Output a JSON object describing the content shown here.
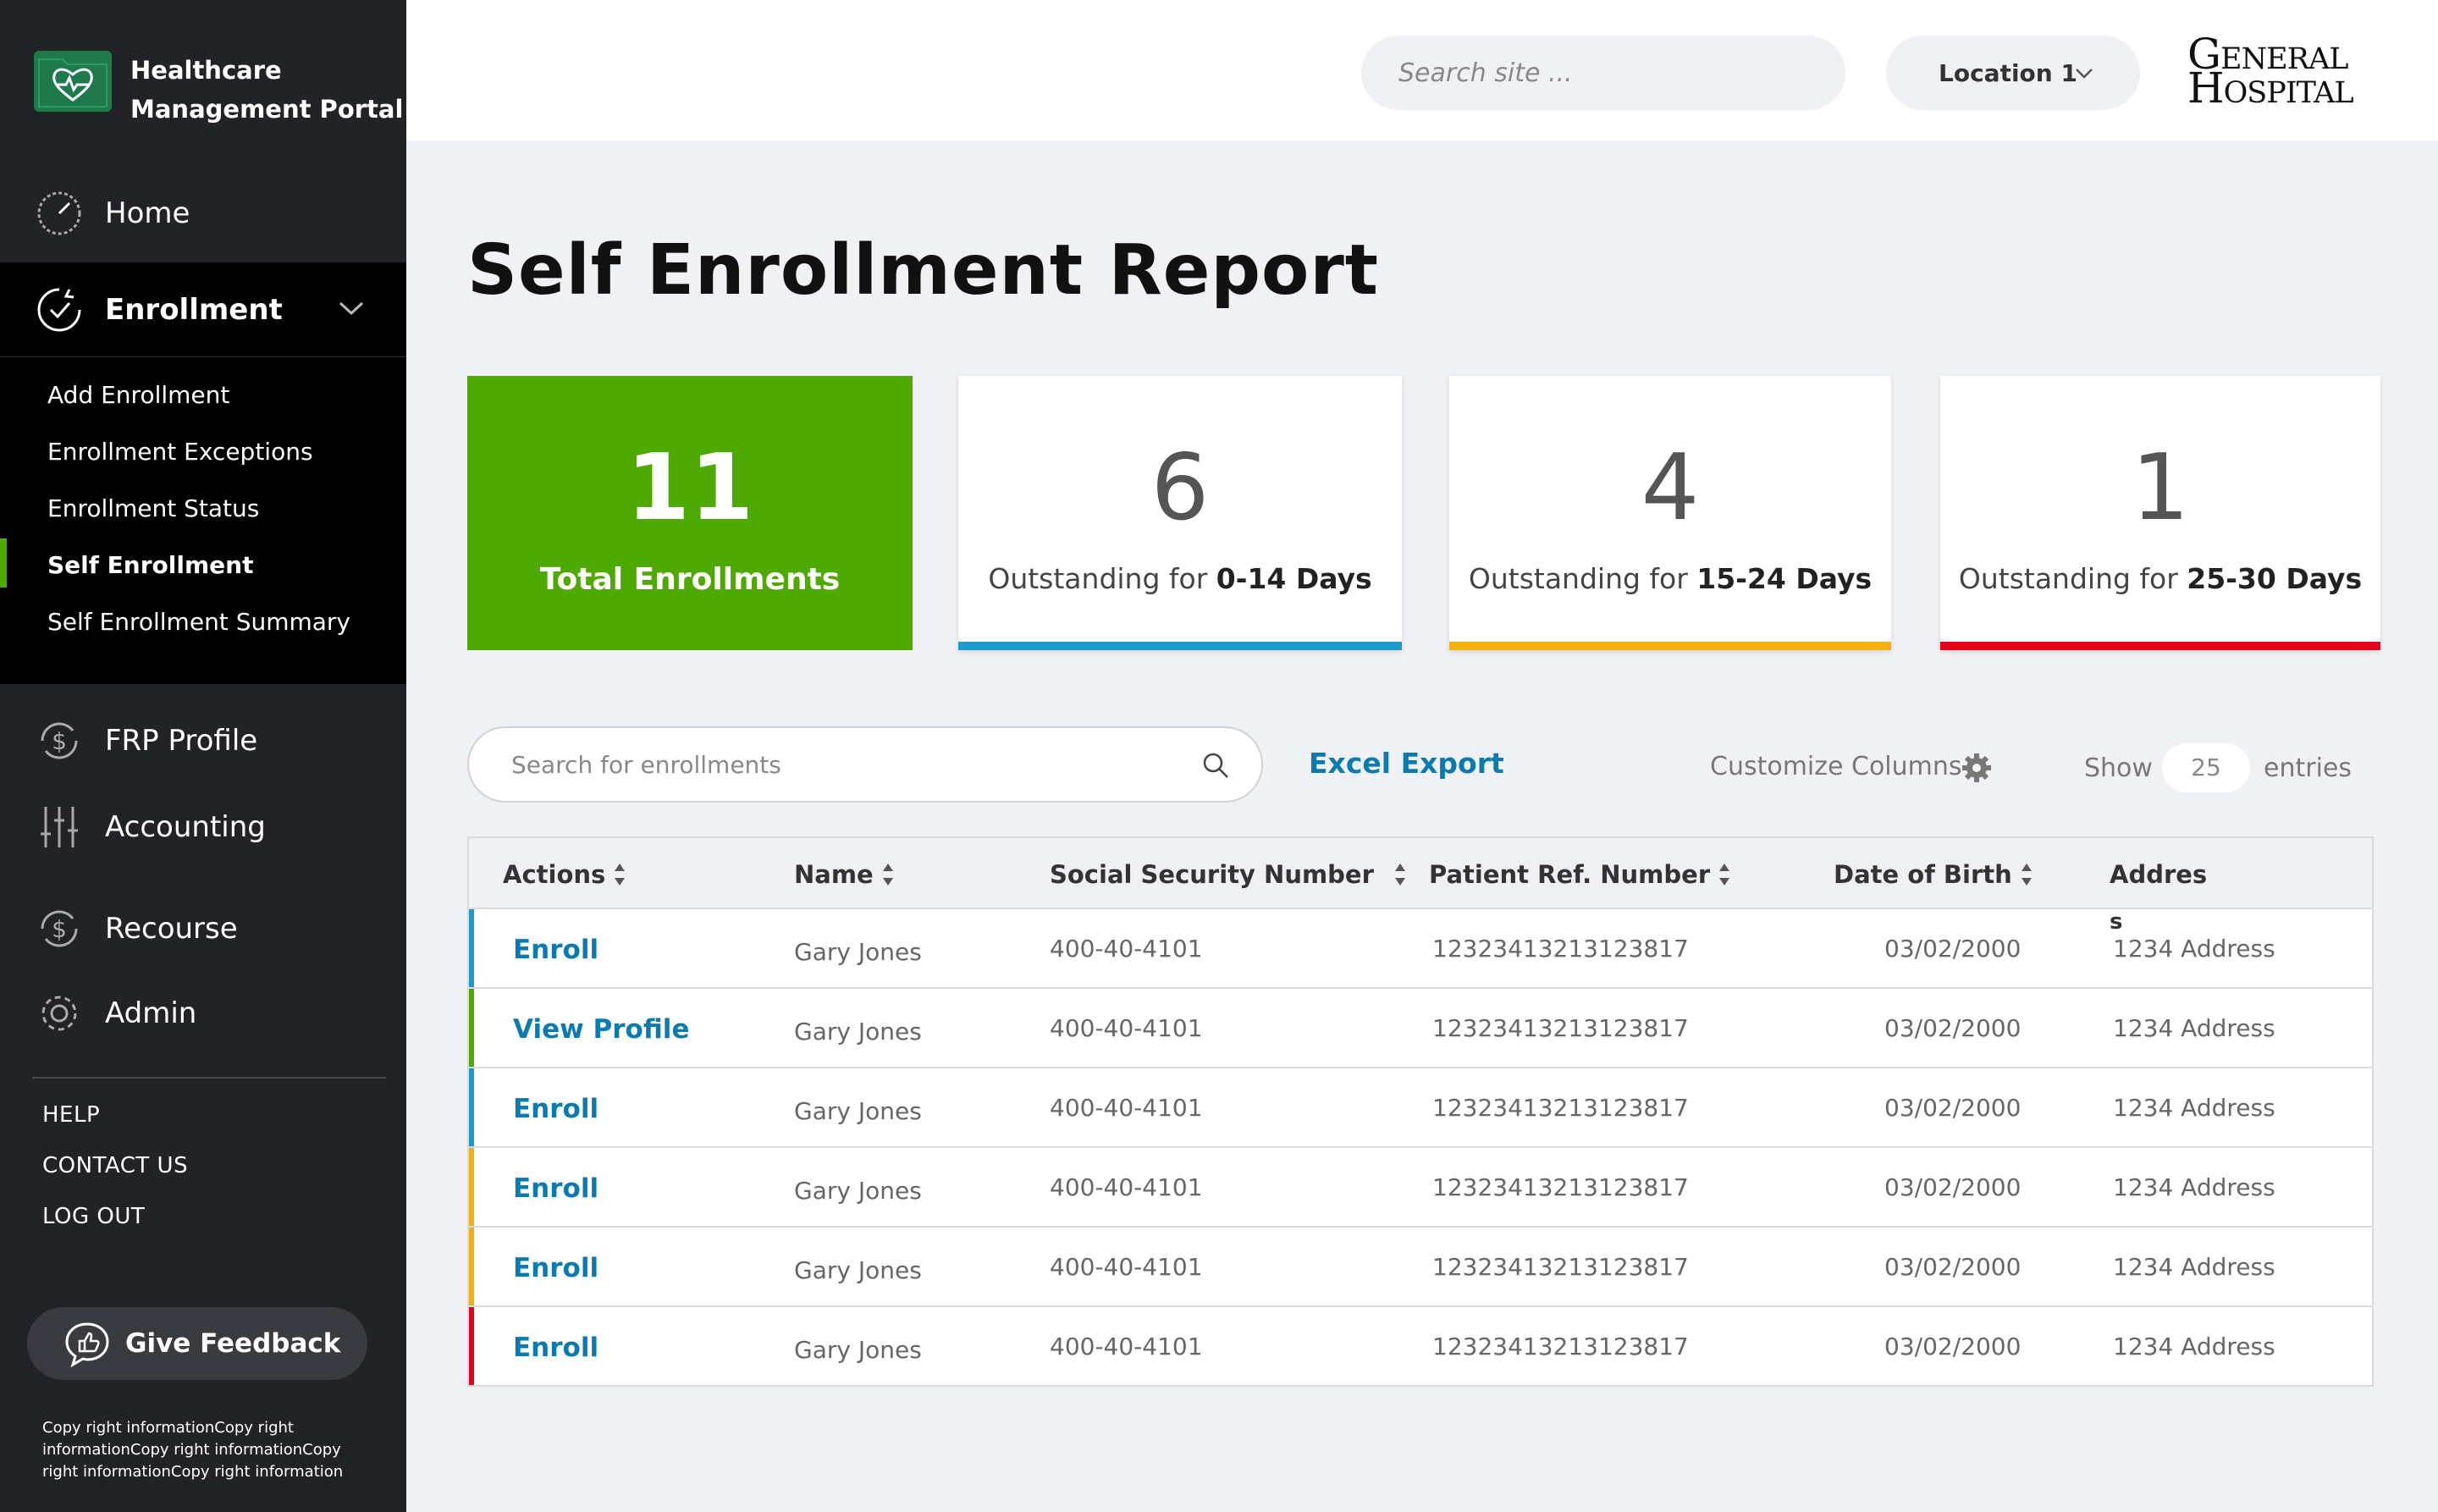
{
  "app": {
    "title_line1": "Healthcare",
    "title_line2": "Management Portal"
  },
  "sidebar": {
    "home": "Home",
    "enrollment": "Enrollment",
    "submenu": [
      "Add Enrollment",
      "Enrollment Exceptions",
      "Enrollment Status",
      "Self Enrollment",
      "Self Enrollment Summary"
    ],
    "active_submenu": "Self Enrollment",
    "frp_profile": "FRP Profile",
    "accounting": "Accounting",
    "recourse": "Recourse",
    "admin": "Admin",
    "help": "HELP",
    "contact": "CONTACT US",
    "logout": "LOG OUT",
    "feedback": "Give Feedback",
    "copyright": "Copy right informationCopy right informationCopy right informationCopy right informationCopy right information"
  },
  "header": {
    "search_placeholder": "Search site ...",
    "location": "Location 1",
    "logo_line1": "General",
    "logo_line2": "Hospital"
  },
  "page": {
    "title": "Self Enrollment Report"
  },
  "cards": [
    {
      "value": "11",
      "label": "Total Enrollments",
      "color": "#4eaa00"
    },
    {
      "value": "6",
      "label_prefix": "Outstanding for ",
      "label_bold": "0-14 Days",
      "color": "#1a9bd0"
    },
    {
      "value": "4",
      "label_prefix": "Outstanding for ",
      "label_bold": "15-24 Days",
      "color": "#f5b10b"
    },
    {
      "value": "1",
      "label_prefix": "Outstanding for ",
      "label_bold": "25-30 Days",
      "color": "#e3061a"
    }
  ],
  "toolbar": {
    "search_placeholder": "Search for enrollments",
    "excel_export": "Excel Export",
    "customize_columns": "Customize Columns",
    "show": "Show",
    "entries_value": "25",
    "entries": "entries"
  },
  "table": {
    "headers": [
      "Actions",
      "Name",
      "Social Security Number",
      "Patient Ref. Number",
      "Date of Birth",
      "Addres"
    ],
    "header_wrap": "s",
    "rows": [
      {
        "action": "Enroll",
        "name": "Gary Jones",
        "ssn": "400-40-4101",
        "ref": "12323413213123817",
        "dob": "03/02/2000",
        "address": "1234 Address",
        "accent": "#1a9bd0"
      },
      {
        "action": "View Profile",
        "name": "Gary Jones",
        "ssn": "400-40-4101",
        "ref": "12323413213123817",
        "dob": "03/02/2000",
        "address": "1234 Address",
        "accent": "#4eaa00"
      },
      {
        "action": "Enroll",
        "name": "Gary Jones",
        "ssn": "400-40-4101",
        "ref": "12323413213123817",
        "dob": "03/02/2000",
        "address": "1234 Address",
        "accent": "#1a9bd0"
      },
      {
        "action": "Enroll",
        "name": "Gary Jones",
        "ssn": "400-40-4101",
        "ref": "12323413213123817",
        "dob": "03/02/2000",
        "address": "1234 Address",
        "accent": "#f5b10b"
      },
      {
        "action": "Enroll",
        "name": "Gary Jones",
        "ssn": "400-40-4101",
        "ref": "12323413213123817",
        "dob": "03/02/2000",
        "address": "1234 Address",
        "accent": "#f5b10b"
      },
      {
        "action": "Enroll",
        "name": "Gary Jones",
        "ssn": "400-40-4101",
        "ref": "12323413213123817",
        "dob": "03/02/2000",
        "address": "1234 Address",
        "accent": "#e3061a"
      }
    ]
  }
}
